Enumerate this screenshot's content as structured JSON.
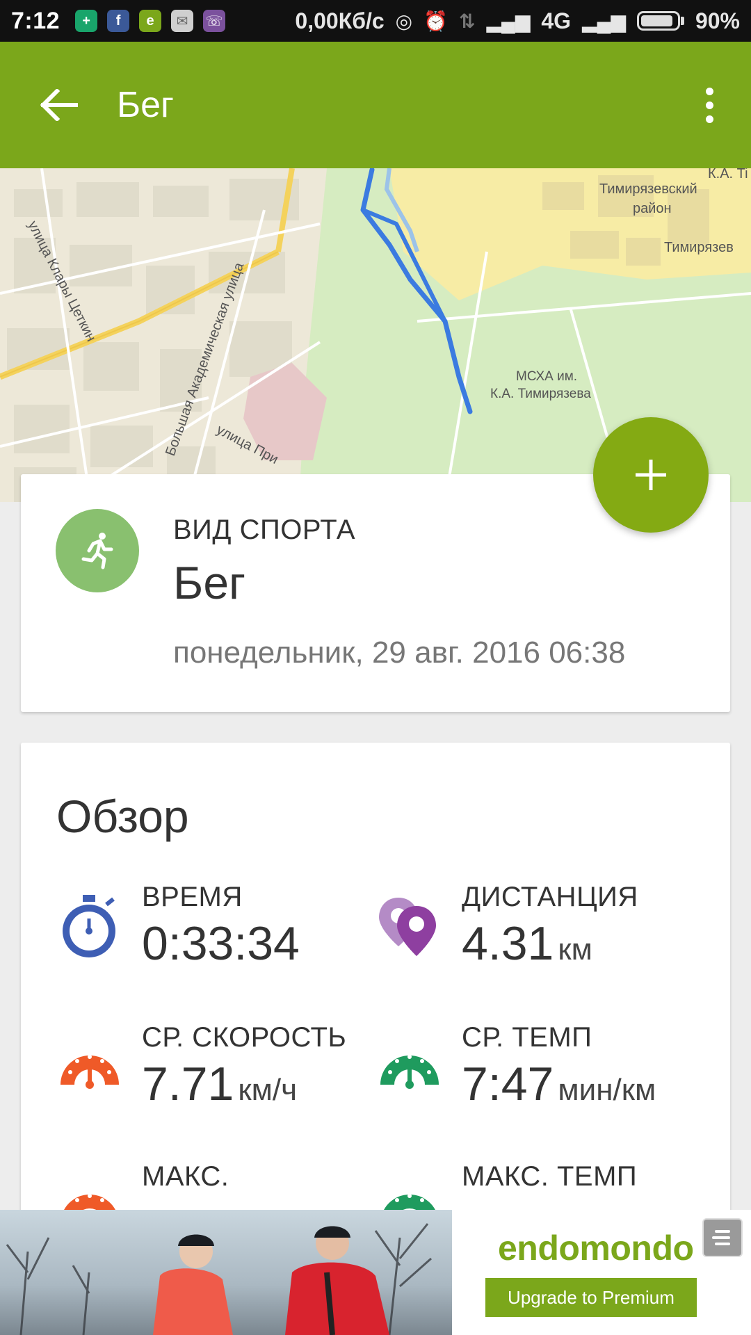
{
  "status_bar": {
    "time": "7:12",
    "network_speed": "0,00Кб/с",
    "network_type": "4G",
    "battery": "90%",
    "battery_level": 0.9,
    "app_icons": [
      "shield-icon",
      "facebook-icon",
      "endomondo-icon",
      "email-icon",
      "viber-icon"
    ]
  },
  "app_bar": {
    "title": "Бег",
    "back_icon": "arrow-back-icon",
    "menu_icon": "more-vert-icon"
  },
  "map": {
    "labels": {
      "street_klary": "улица Клары Цеткин",
      "street_akadem": "Большая Академическая улица",
      "street_prya": "улица При",
      "district_1": "Тимирязевский",
      "district_2": "район",
      "district_3": "Тимирязев",
      "ka_short": "К.А. Ti",
      "mska_1": "МСХА им.",
      "mska_2": "К.А. Тимирязева"
    },
    "route_color": "#3b7be0"
  },
  "fab": {
    "icon": "plus-icon",
    "color": "#84aa13"
  },
  "sport_card": {
    "label": "ВИД СПОРТА",
    "value": "Бег",
    "date": "понедельник, 29 авг. 2016 06:38",
    "icon": "running-icon"
  },
  "overview": {
    "title": "Обзор",
    "stats": [
      {
        "label": "ВРЕМЯ",
        "value": "0:33:34",
        "unit": "",
        "icon": "stopwatch-icon",
        "color": "#3e5eb4"
      },
      {
        "label": "ДИСТАНЦИЯ",
        "value": "4.31",
        "unit": "км",
        "icon": "map-pins-icon",
        "color": "#8e3fa0"
      },
      {
        "label": "СР. СКОРОСТЬ",
        "value": "7.71",
        "unit": "км/ч",
        "icon": "speedometer-icon",
        "color": "#ef5a28"
      },
      {
        "label": "СР. ТЕМП",
        "value": "7:47",
        "unit": "мин/км",
        "icon": "pace-icon",
        "color": "#1f9b5e"
      },
      {
        "label": "МАКС.",
        "value": "",
        "unit": "",
        "icon": "max-speed-icon",
        "color": "#ef5a28"
      },
      {
        "label": "МАКС. ТЕМП",
        "value": "",
        "unit": "",
        "icon": "max-pace-icon",
        "color": "#1f9b5e"
      }
    ]
  },
  "ad": {
    "brand": "endomondo",
    "cta": "Upgrade to Premium"
  }
}
